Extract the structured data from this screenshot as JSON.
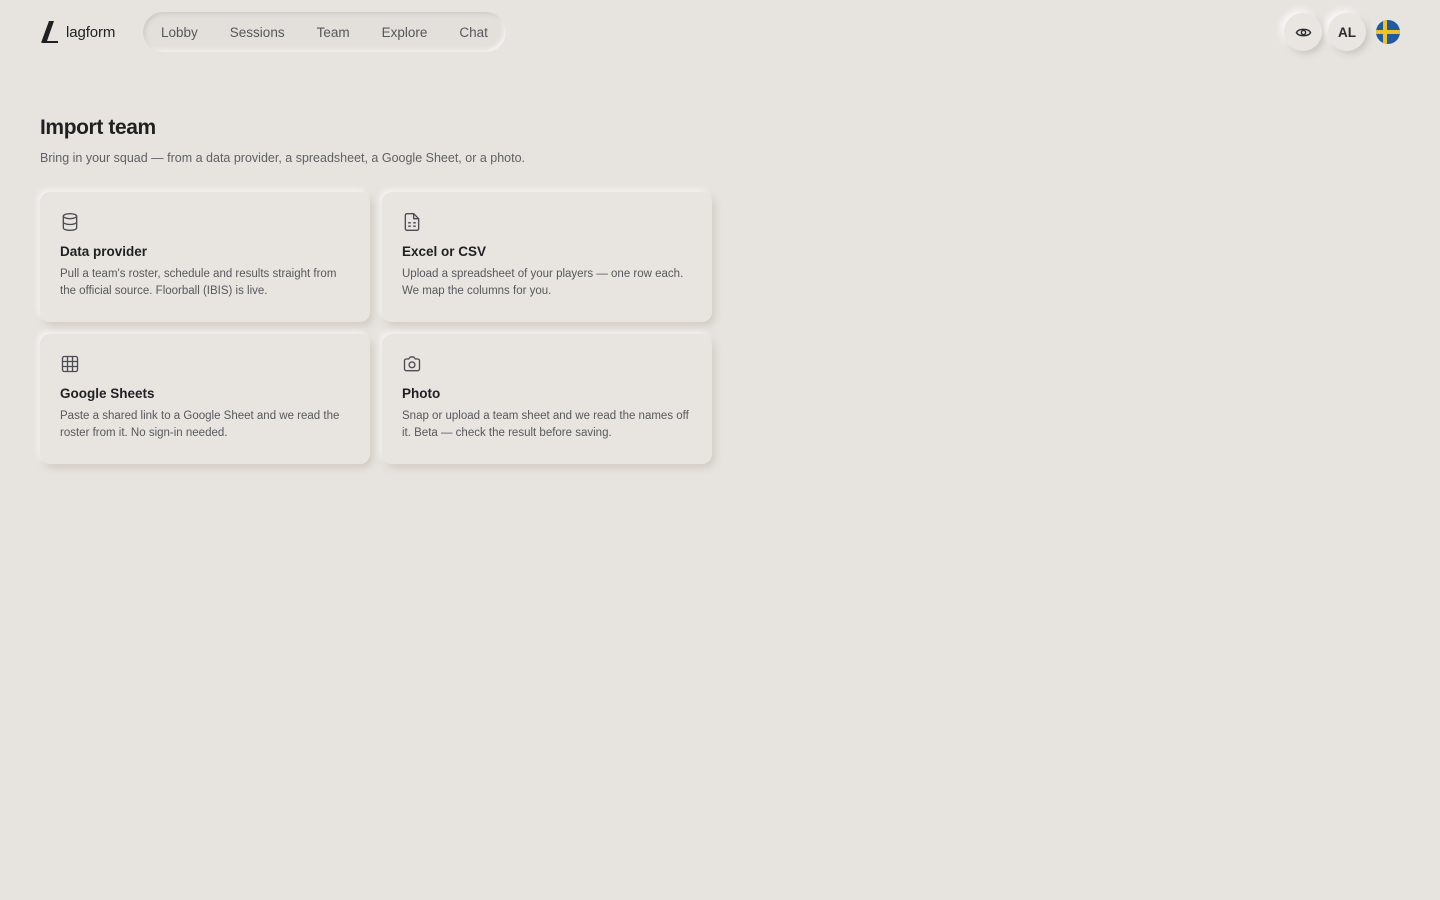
{
  "brand": {
    "name": "lagform"
  },
  "nav": {
    "items": [
      {
        "label": "Lobby"
      },
      {
        "label": "Sessions"
      },
      {
        "label": "Team"
      },
      {
        "label": "Explore"
      },
      {
        "label": "Chat"
      }
    ]
  },
  "header_actions": {
    "visibility_icon": "eye-icon",
    "avatar_initials": "AL",
    "language_flag": "sweden-flag-icon"
  },
  "page": {
    "title": "Import team",
    "subtitle": "Bring in your squad — from a data provider, a spreadsheet, a Google Sheet, or a photo."
  },
  "options": [
    {
      "icon": "database-icon",
      "title": "Data provider",
      "description": "Pull a team's roster, schedule and results straight from the official source. Floorball (IBIS) is live."
    },
    {
      "icon": "spreadsheet-file-icon",
      "title": "Excel or CSV",
      "description": "Upload a spreadsheet of your players — one row each. We map the columns for you."
    },
    {
      "icon": "table-grid-icon",
      "title": "Google Sheets",
      "description": "Paste a shared link to a Google Sheet and we read the roster from it. No sign-in needed."
    },
    {
      "icon": "camera-icon",
      "title": "Photo",
      "description": "Snap or upload a team sheet and we read the names off it. Beta — check the result before saving."
    }
  ],
  "colors": {
    "background": "#e7e4e0",
    "text_primary": "#1f2024",
    "text_secondary": "#56585e",
    "flag_blue": "#1f5aa6",
    "flag_yellow": "#f2c318"
  }
}
